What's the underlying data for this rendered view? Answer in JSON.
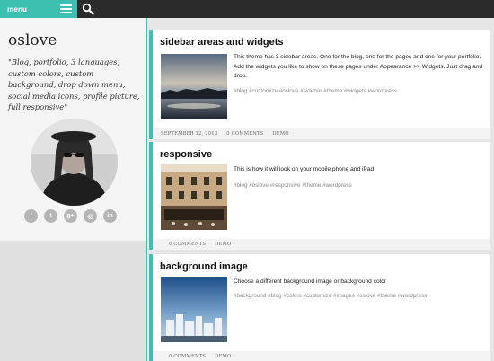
{
  "topbar": {
    "menu_label": "menu",
    "menu_icon": "hamburger-icon",
    "search_icon": "search-icon",
    "accent_color": "#3ec0b0"
  },
  "sidebar": {
    "site_title": "oslove",
    "tagline": "\"Blog, portfolio, 3 languages, custom colors, custom background, drop down menu, social media icons, profile picture, full responsive\"",
    "social": [
      {
        "icon": "facebook-icon",
        "glyph": "f"
      },
      {
        "icon": "twitter-icon",
        "glyph": "t"
      },
      {
        "icon": "google-plus-icon",
        "glyph": "g+"
      },
      {
        "icon": "instagram-icon",
        "glyph": "◎"
      },
      {
        "icon": "linkedin-icon",
        "glyph": "in"
      }
    ]
  },
  "posts": [
    {
      "title": "sidebar areas and widgets",
      "excerpt": "This theme has 3 sidebar areas. One for the blog, one for the pages and one for your portfolio. Add the widgets you like to show on these pages under Appearance >> Widgets. Just drag and drop.",
      "tags": "#blog #customize #oslove #sidebar #theme #widgets #wordpress",
      "date": "SEPTEMBER 12, 2013",
      "comments": "0 COMMENTS",
      "category": "DEMO"
    },
    {
      "title": "responsive",
      "excerpt": "This is how it will look on your mobile phone and iPad",
      "tags": "#blog #oslove #responsive #theme #wordpress",
      "date": "",
      "comments": "0 COMMENTS",
      "category": "DEMO"
    },
    {
      "title": "background image",
      "excerpt": "Choose a different background image or background color",
      "tags": "#background #blog #colors #customize #images #oslove #theme #wordpress",
      "date": "",
      "comments": "0 COMMENTS",
      "category": "DEMO"
    }
  ]
}
